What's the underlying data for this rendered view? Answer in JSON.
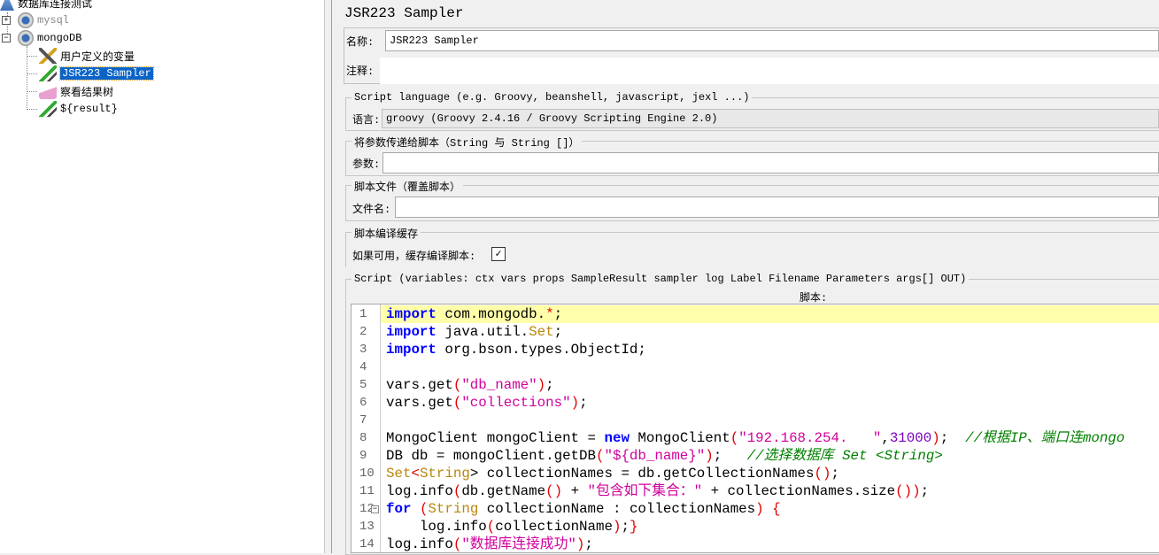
{
  "tree": {
    "root": "数据库连接测试",
    "items": [
      {
        "label": "mysql",
        "icon": "gear-icon"
      },
      {
        "label": "mongoDB",
        "icon": "gear-icon"
      },
      {
        "label": "用户定义的变量",
        "icon": "wrench-icon"
      },
      {
        "label": "JSR223 Sampler",
        "icon": "pipette-icon",
        "selected": true
      },
      {
        "label": "察看结果树",
        "icon": "graph-icon"
      },
      {
        "label": "${result}",
        "icon": "pipette-icon"
      }
    ]
  },
  "panel": {
    "title": "JSR223 Sampler",
    "name_label": "名称:",
    "name_value": "JSR223 Sampler",
    "comment_label": "注释:",
    "lang_group": "Script language (e.g. Groovy, beanshell, javascript, jexl ...)",
    "lang_label": "语言:",
    "lang_value": "groovy     (Groovy 2.4.16 / Groovy Scripting Engine 2.0)",
    "params_group": "将参数传递给脚本（String 与 String []）",
    "params_label": "参数:",
    "file_group": "脚本文件（覆盖脚本）",
    "file_label": "文件名:",
    "cache_group": "脚本编译缓存",
    "cache_label": "如果可用，缓存编译脚本:",
    "cache_checked": true,
    "script_group": "Script (variables: ctx vars props SampleResult sampler log Label Filename Parameters args[] OUT)",
    "script_label": "脚本:"
  },
  "code": [
    [
      [
        "import",
        "kw"
      ],
      [
        " com.mongodb.",
        "pl"
      ],
      [
        "*",
        "op"
      ],
      [
        ";",
        "pl"
      ]
    ],
    [
      [
        "import",
        "kw"
      ],
      [
        " java.util.",
        "pl"
      ],
      [
        "Set",
        "ty"
      ],
      [
        ";",
        "pl"
      ]
    ],
    [
      [
        "import",
        "kw"
      ],
      [
        " org.bson.types.ObjectId;",
        "pl"
      ]
    ],
    [],
    [
      [
        "vars.get",
        "pl"
      ],
      [
        "(",
        "op"
      ],
      [
        "\"db_name\"",
        "st"
      ],
      [
        ")",
        "op"
      ],
      [
        ";",
        "pl"
      ]
    ],
    [
      [
        "vars.get",
        "pl"
      ],
      [
        "(",
        "op"
      ],
      [
        "\"collections\"",
        "st"
      ],
      [
        ")",
        "op"
      ],
      [
        ";",
        "pl"
      ]
    ],
    [],
    [
      [
        "MongoClient mongoClient = ",
        "pl"
      ],
      [
        "new",
        "kw"
      ],
      [
        " MongoClient",
        "pl"
      ],
      [
        "(",
        "op"
      ],
      [
        "\"192.168.254.   \"",
        "st"
      ],
      [
        ",",
        "pl"
      ],
      [
        "31000",
        "nm"
      ],
      [
        ")",
        "op"
      ],
      [
        ";  ",
        "pl"
      ],
      [
        "//根据IP、端口连mongo",
        "cm"
      ]
    ],
    [
      [
        "DB db = mongoClient.getDB",
        "pl"
      ],
      [
        "(",
        "op"
      ],
      [
        "\"${db_name}\"",
        "st"
      ],
      [
        ")",
        "op"
      ],
      [
        ";   ",
        "pl"
      ],
      [
        "//选择数据库 Set <String>",
        "cm"
      ]
    ],
    [
      [
        "Set",
        "ty"
      ],
      [
        "<",
        "op"
      ],
      [
        "String",
        "ty"
      ],
      [
        "> collectionNames = db.getCollectionNames",
        "pl"
      ],
      [
        "()",
        "op"
      ],
      [
        ";",
        "pl"
      ]
    ],
    [
      [
        "log.info",
        "pl"
      ],
      [
        "(",
        "op"
      ],
      [
        "db.getName",
        "pl"
      ],
      [
        "()",
        "op"
      ],
      [
        " + ",
        "pl"
      ],
      [
        "\"包含如下集合：\"",
        "st"
      ],
      [
        " + collectionNames.size",
        "pl"
      ],
      [
        "())",
        "op"
      ],
      [
        ";",
        "pl"
      ]
    ],
    [
      [
        "for",
        "kw"
      ],
      [
        " ",
        "pl"
      ],
      [
        "(",
        "op"
      ],
      [
        "String",
        "ty"
      ],
      [
        " collectionName : collectionNames",
        "pl"
      ],
      [
        ")",
        "op"
      ],
      [
        " ",
        "pl"
      ],
      [
        "{",
        "op"
      ]
    ],
    [
      [
        "    log.info",
        "pl"
      ],
      [
        "(",
        "op"
      ],
      [
        "collectionName",
        "pl"
      ],
      [
        ")",
        "op"
      ],
      [
        ";",
        "pl"
      ],
      [
        "}",
        "op"
      ]
    ],
    [
      [
        "log.info",
        "pl"
      ],
      [
        "(",
        "op"
      ],
      [
        "\"数据库连接成功\"",
        "st"
      ],
      [
        ")",
        "op"
      ],
      [
        ";",
        "pl"
      ]
    ]
  ]
}
